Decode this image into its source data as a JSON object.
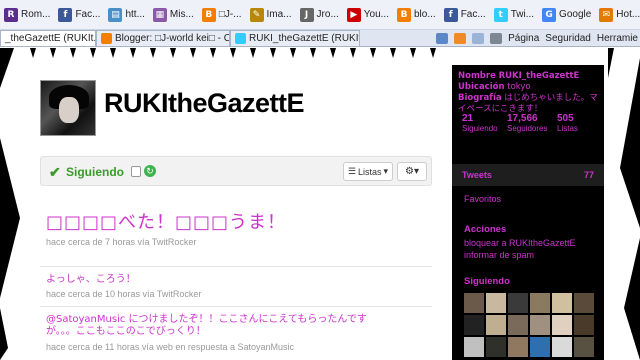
{
  "favorites": [
    {
      "label": "Rom...",
      "icon": "rom-favicon",
      "glyph": "R",
      "color": "#5b2d8e"
    },
    {
      "label": "Fac...",
      "icon": "facebook-favicon",
      "glyph": "f",
      "color": "#3b5998"
    },
    {
      "label": "htt...",
      "icon": "web-favicon",
      "glyph": "▤",
      "color": "#4a90c8"
    },
    {
      "label": "Mis...",
      "icon": "image-favicon",
      "glyph": "▦",
      "color": "#8a5aa8"
    },
    {
      "label": "□J-...",
      "icon": "blogger-favicon",
      "glyph": "B",
      "color": "#f57d00"
    },
    {
      "label": "Ima...",
      "icon": "image-search-favicon",
      "glyph": "✎",
      "color": "#b8860b"
    },
    {
      "label": "Jro...",
      "icon": "jro-favicon",
      "glyph": "J",
      "color": "#666666"
    },
    {
      "label": "You...",
      "icon": "youtube-favicon",
      "glyph": "▶",
      "color": "#cc0000"
    },
    {
      "label": "blo...",
      "icon": "blogger-favicon",
      "glyph": "B",
      "color": "#f57d00"
    },
    {
      "label": "Fac...",
      "icon": "facebook-favicon",
      "glyph": "f",
      "color": "#3b5998"
    },
    {
      "label": "Twi...",
      "icon": "twitter-favicon",
      "glyph": "t",
      "color": "#33ccff"
    },
    {
      "label": "Google",
      "icon": "google-favicon",
      "glyph": "G",
      "color": "#4285f4"
    },
    {
      "label": "Hot...",
      "icon": "hotmail-favicon",
      "glyph": "✉",
      "color": "#e07b00"
    }
  ],
  "tabs": [
    {
      "label": "_theGazettE (RUKIt...",
      "icon": "twitter-tab-icon",
      "color": "#33ccff"
    },
    {
      "label": "Blogger: □J-world kei□ - C...",
      "icon": "blogger-tab-icon",
      "color": "#f57d00"
    },
    {
      "label": "RUKI_theGazettE (RUKIthe...",
      "icon": "twitter-tab-icon",
      "color": "#33ccff"
    }
  ],
  "toolbar": {
    "page_label": "Página",
    "security_label": "Seguridad",
    "tools_label": "Herramie"
  },
  "profile": {
    "username": "RUKItheGazettE"
  },
  "actions": {
    "following_label": "Siguiendo",
    "lists_label": "Listas"
  },
  "tweets": [
    {
      "text": "□□□□べた！□□□うま！",
      "meta": "hace cerca de 7 horas vía TwitRocker"
    },
    {
      "text": "よっしゃ、ころう！",
      "meta": "hace cerca de 10 horas vía TwitRocker"
    },
    {
      "text": "@SatoyanMusic につけましたぞ！！ここさんにこえてもらったんですが。。。ここもここのこでびっくり！",
      "meta": "hace cerca de 11 horas vía web en respuesta a SatoyanMusic"
    }
  ],
  "sidebar": {
    "name_label": "Nombre",
    "name_value": "RUKI_theGazettE",
    "location_label": "Ubicación",
    "location_value": "tokyo",
    "bio_label": "Biografía",
    "bio_value": "はじめちゃいました。マイペースにこきます！",
    "stats": [
      {
        "number": "21",
        "label": "Siguiendo"
      },
      {
        "number": "17,566",
        "label": "Seguidores"
      },
      {
        "number": "505",
        "label": "Listas"
      }
    ],
    "tweets_label": "Tweets",
    "tweets_count": "77",
    "favorites_label": "Favoritos",
    "actions_title": "Acciones",
    "block_label": "bloquear a RUKItheGazettE",
    "spam_label": "informar de spam",
    "following_title": "Siguiendo",
    "friend_colors": [
      "#6b5a4a",
      "#c9b8a0",
      "#3a3a3a",
      "#8a7a60",
      "#d0c0a0",
      "#5a4a3a",
      "#222222",
      "#bfae90",
      "#7a6a5a",
      "#a09080",
      "#e0d0c0",
      "#4a3a2a",
      "#c0c0c0",
      "#30302a",
      "#907860",
      "#2e6fb0",
      "#dadada",
      "#585040"
    ]
  },
  "colors": {
    "accent": "#cc33cc",
    "following_green": "#3a9a2a"
  }
}
